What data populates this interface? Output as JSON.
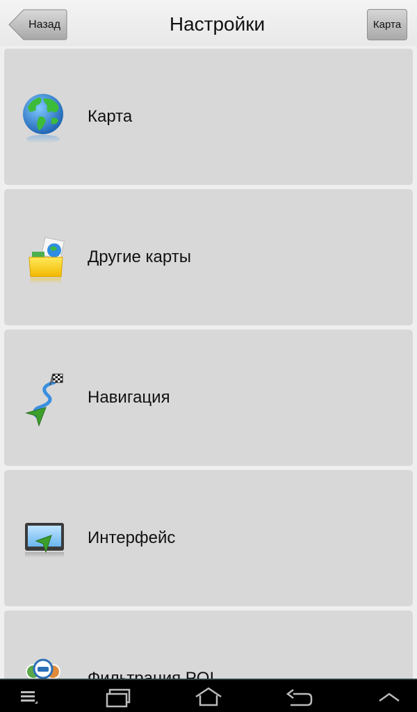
{
  "header": {
    "back_label": "Назад",
    "title": "Настройки",
    "map_label": "Карта"
  },
  "menu": {
    "items": [
      {
        "label": "Карта",
        "icon": "globe-icon"
      },
      {
        "label": "Другие карты",
        "icon": "folder-globe-icon"
      },
      {
        "label": "Навигация",
        "icon": "route-flag-icon"
      },
      {
        "label": "Интерфейс",
        "icon": "screen-arrow-icon"
      },
      {
        "label": "Фильтрация POI",
        "icon": "poi-filter-icon"
      }
    ]
  },
  "system_nav": {
    "buttons": [
      "menu-icon",
      "recent-apps-icon",
      "home-icon",
      "back-icon",
      "up-chevron-icon"
    ]
  },
  "colors": {
    "item_background": "#d8d8d8",
    "page_background": "#efefef",
    "navbar_background": "#000000"
  }
}
